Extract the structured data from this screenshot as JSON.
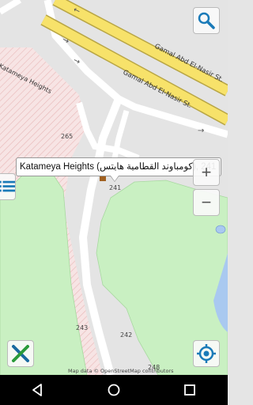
{
  "map": {
    "street_labels": [
      "Gamal Abd El-Nasir St.",
      "Gamal Abd El-Nasir St."
    ],
    "area_label": "Katameya Heights",
    "poi_numbers": [
      "265",
      "241",
      "243",
      "242",
      "248"
    ],
    "attribution": "Map data © OpenStreetMap contributors"
  },
  "callout": {
    "text": "Katameya Heights (كومباوند القطامية هايتس), 241"
  },
  "controls": {
    "search_icon": "search-icon",
    "zoom_in_label": "+",
    "zoom_out_label": "−",
    "list_icon": "list-icon",
    "close_icon": "close-icon",
    "locate_icon": "locate-icon"
  },
  "colors": {
    "road_yellow": "#f7e26a",
    "road_border": "#bba846",
    "park_green": "#c8f0c0",
    "water": "#a8c8f0",
    "residential": "#f4dede"
  },
  "navbar": {
    "back_icon": "back-icon",
    "home_icon": "home-icon",
    "recents_icon": "recents-icon"
  }
}
